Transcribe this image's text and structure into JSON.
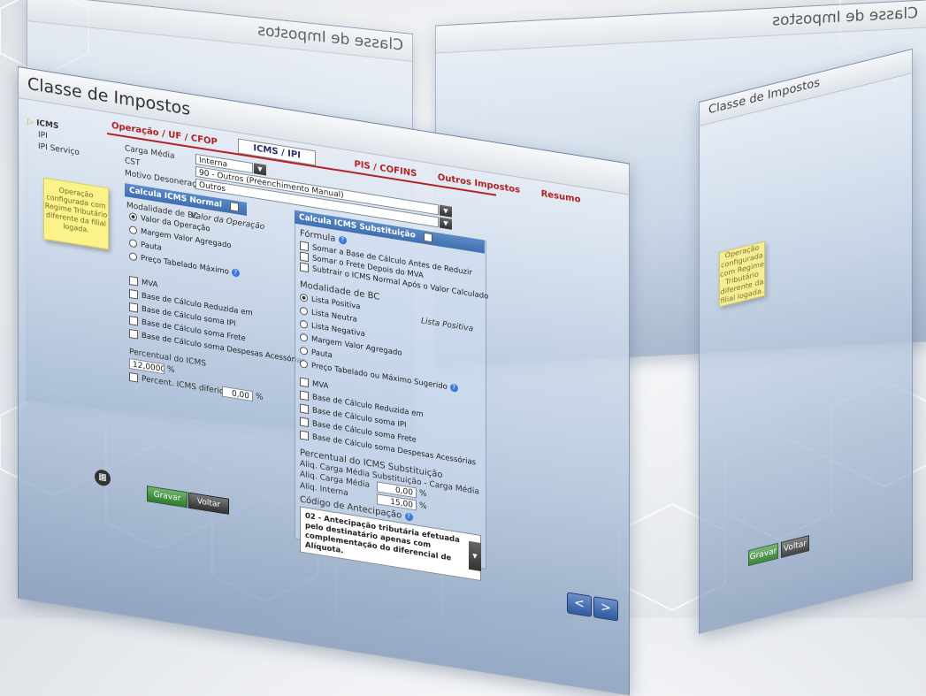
{
  "app": {
    "title": "Classe de Impostos"
  },
  "tabs": [
    "Operação / UF / CFOP",
    "ICMS / IPI",
    "PIS / COFINS",
    "Outros Impostos",
    "Resumo"
  ],
  "sidebar": {
    "items": [
      "ICMS",
      "IPI",
      "IPI Serviço"
    ]
  },
  "form": {
    "carga_media_label": "Carga Média",
    "carga_media_value": "Interna",
    "cst_label": "CST",
    "cst_value": "90 - Outros (Preenchimento Manual)",
    "motivo_label": "Motivo Desoneração",
    "motivo_value": "Outros"
  },
  "note": {
    "text": "Operação configurada com Regime Tributário diferente da filial logada."
  },
  "icms_normal": {
    "header": "Calcula ICMS Normal",
    "modalidade_label": "Modalidade de BC",
    "modalidade_value": "Valor da Operação",
    "options": [
      "Valor da Operação",
      "Margem Valor Agregado",
      "Pauta",
      "Preço Tabelado Máximo"
    ],
    "checks": [
      "MVA",
      "Base de Cálculo Reduzida em",
      "Base de Cálculo soma IPI",
      "Base de Cálculo soma Frete",
      "Base de Cálculo soma Despesas Acessórias"
    ],
    "percentual_label": "Percentual do ICMS",
    "percentual_value": "12,0000",
    "percentual_unit": "%",
    "diferido_label": "Percent. ICMS diferido em",
    "diferido_value": "0,00",
    "diferido_unit": "%"
  },
  "icms_st": {
    "header": "Calcula ICMS Substituição",
    "formula_label": "Fórmula",
    "formula_checks": [
      "Somar a Base de Cálculo Antes de Reduzir",
      "Somar o Frete Depois do MVA",
      "Subtrair o ICMS Normal Após o Valor Calculado"
    ],
    "modalidade_label": "Modalidade de BC",
    "modalidade_value": "Lista Positiva",
    "options": [
      "Lista Positiva",
      "Lista Neutra",
      "Lista Negativa",
      "Margem Valor Agregado",
      "Pauta",
      "Preço Tabelado ou Máximo Sugerido"
    ],
    "checks": [
      "MVA",
      "Base de Cálculo Reduzida em",
      "Base de Cálculo soma IPI",
      "Base de Cálculo soma Frete",
      "Base de Cálculo soma Despesas Acessórias"
    ],
    "percentual_label": "Percentual do ICMS Substituição",
    "aliq_header": "Aliq. Carga Média Substituição - Carga Média",
    "aliq_carga_label": "Aliq. Carga Média",
    "aliq_carga_value": "0,00",
    "aliq_interna_label": "Aliq. Interna",
    "aliq_interna_value": "15,00",
    "unit": "%",
    "codigo_label": "Código de Antecipação",
    "codigo_text": "02 - Antecipação tributária efetuada pelo destinatário apenas com complementação do diferencial de Alíquota."
  },
  "buttons": {
    "gravar": "Gravar",
    "voltar": "Voltar",
    "prev": "<",
    "next": ">"
  },
  "colors": {
    "accent": "#b22222",
    "header_blue": "#3f6fae",
    "note_yellow": "#fbf28a",
    "green": "#2f7a2e"
  }
}
